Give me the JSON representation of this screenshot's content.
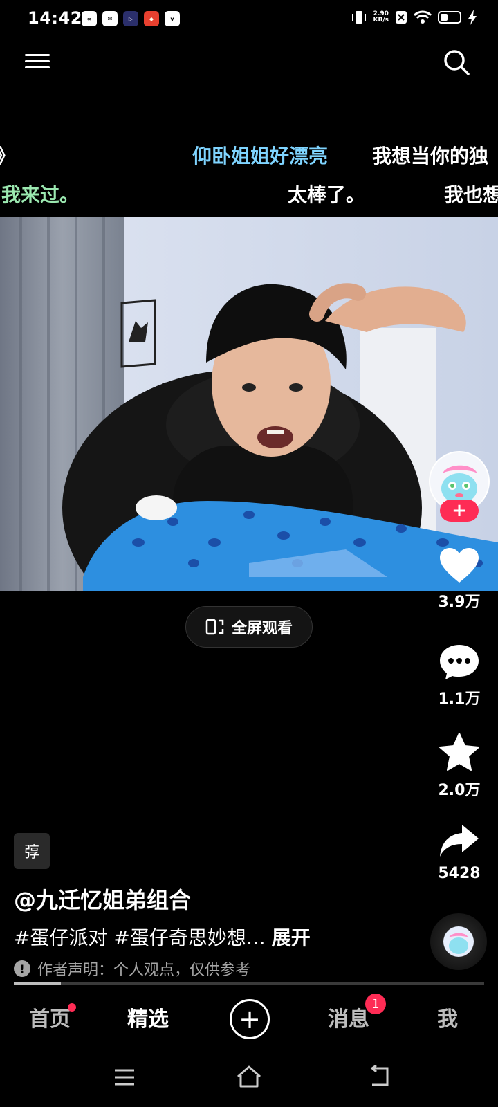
{
  "status_bar": {
    "time": "14:42",
    "app_icons": [
      "infinity-app-icon",
      "mail-app-icon",
      "video-app-icon",
      "game-app-icon",
      "vivo-app-icon"
    ],
    "net_speed_value": "2.90",
    "net_speed_unit": "KB/s"
  },
  "danmaku": [
    {
      "text": "》",
      "color": "#ffffff"
    },
    {
      "text": "仰卧姐姐好漂亮",
      "color": "#7fd4ff"
    },
    {
      "text": "我想当你的独",
      "color": "#ffffff"
    },
    {
      "text": "我来过。",
      "color": "#9be8b0"
    },
    {
      "text": "太棒了。",
      "color": "#ffffff"
    },
    {
      "text": "我也想",
      "color": "#ffffff"
    }
  ],
  "fullscreen_label": "全屏观看",
  "actions": {
    "like_count": "3.9万",
    "comment_count": "1.1万",
    "favorite_count": "2.0万",
    "share_count": "5428"
  },
  "caption": {
    "tag_chip": "弴",
    "author": "@九迁忆姐弟组合",
    "hashtags": "#蛋仔派对 #蛋仔奇思妙想… ",
    "expand": "展开",
    "disclaimer": "作者声明：个人观点，仅供参考"
  },
  "progress_percent": 10,
  "bottom_nav": {
    "home": "首页",
    "featured": "精选",
    "messages": "消息",
    "messages_badge": "1",
    "me": "我"
  },
  "colors": {
    "accent": "#fe2c55",
    "danmaku_blue": "#7fd4ff",
    "danmaku_green": "#9be8b0"
  }
}
